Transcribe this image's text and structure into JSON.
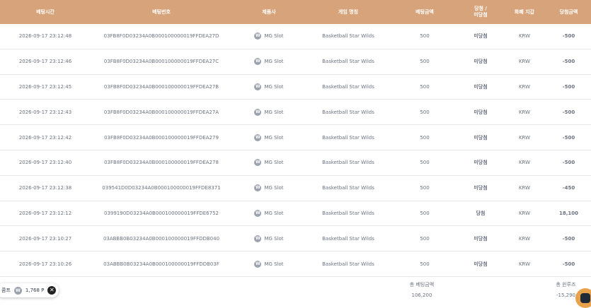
{
  "headers": {
    "bet_time": "베팅시간",
    "bet_number": "베팅번호",
    "provider": "제품사",
    "game_name": "게임 명칭",
    "bet_amount": "베팅금액",
    "result_line1": "당첨 /",
    "result_line2": "미당첨",
    "currency": "화폐 지갑",
    "win_amount": "당첨금액"
  },
  "rows": [
    {
      "time": "2026-09-17 23:12:48",
      "bet_id": "03FB8F0D03234A0B000100000019FFDEA27D",
      "provider": "MG Slot",
      "game": "Basketball Star Wilds",
      "bet": "500",
      "result": "미당첨",
      "result_type": "lose",
      "currency": "KRW",
      "amount": "-500"
    },
    {
      "time": "2026-09-17 23:12:46",
      "bet_id": "03FB8F0D03234A0B000100000019FFDEA27C",
      "provider": "MG Slot",
      "game": "Basketball Star Wilds",
      "bet": "500",
      "result": "미당첨",
      "result_type": "lose",
      "currency": "KRW",
      "amount": "-500"
    },
    {
      "time": "2026-09-17 23:12:45",
      "bet_id": "03FB8F0D03234A0B000100000019FFDEA27B",
      "provider": "MG Slot",
      "game": "Basketball Star Wilds",
      "bet": "500",
      "result": "미당첨",
      "result_type": "lose",
      "currency": "KRW",
      "amount": "-500"
    },
    {
      "time": "2026-09-17 23:12:43",
      "bet_id": "03FB8F0D03234A0B000100000019FFDEA27A",
      "provider": "MG Slot",
      "game": "Basketball Star Wilds",
      "bet": "500",
      "result": "미당첨",
      "result_type": "lose",
      "currency": "KRW",
      "amount": "-500"
    },
    {
      "time": "2026-09-17 23:12:42",
      "bet_id": "03FB8F0D03234A0B000100000019FFDEA279",
      "provider": "MG Slot",
      "game": "Basketball Star Wilds",
      "bet": "500",
      "result": "미당첨",
      "result_type": "lose",
      "currency": "KRW",
      "amount": "-500"
    },
    {
      "time": "2026-09-17 23:12:40",
      "bet_id": "03FB8F0D03234A0B000100000019FFDEA278",
      "provider": "MG Slot",
      "game": "Basketball Star Wilds",
      "bet": "500",
      "result": "미당첨",
      "result_type": "lose",
      "currency": "KRW",
      "amount": "-500"
    },
    {
      "time": "2026-09-17 23:12:38",
      "bet_id": "039541D0D03234A0B000100000019FFDE8371",
      "provider": "MG Slot",
      "game": "Basketball Star Wilds",
      "bet": "500",
      "result": "미당첨",
      "result_type": "lose",
      "currency": "KRW",
      "amount": "-450"
    },
    {
      "time": "2026-09-17 23:12:12",
      "bet_id": "0399190D03234A0B000100000019FFDE6752",
      "provider": "MG Slot",
      "game": "Basketball Star Wilds",
      "bet": "500",
      "result": "당첨",
      "result_type": "win",
      "currency": "KRW",
      "amount": "18,100"
    },
    {
      "time": "2026-09-17 23:10:27",
      "bet_id": "03ABBB0B03234A0B000100000019FFDDB040",
      "provider": "MG Slot",
      "game": "Basketball Star Wilds",
      "bet": "500",
      "result": "미당첨",
      "result_type": "lose",
      "currency": "KRW",
      "amount": "-500"
    },
    {
      "time": "2026-09-17 23:10:26",
      "bet_id": "03ABBB0B03234A0B000100000019FFDDB03F",
      "provider": "MG Slot",
      "game": "Basketball Star Wilds",
      "bet": "500",
      "result": "미당첨",
      "result_type": "lose",
      "currency": "KRW",
      "amount": "-500"
    }
  ],
  "provider_logo_letter": "W",
  "summary": {
    "total_bet_label": "총 베팅금액",
    "total_bet_value": "106,200",
    "total_win_label": "총 윈루즈",
    "total_win_value": "-15,290"
  },
  "points": {
    "prefix": "콤프",
    "value": "1,768 P",
    "icon_letter": "W",
    "close": "✕"
  },
  "colors": {
    "header_bg": "#d7a37a",
    "lose": "#ef4444",
    "win": "#16a34a",
    "chat_button": "#e8a24b"
  }
}
